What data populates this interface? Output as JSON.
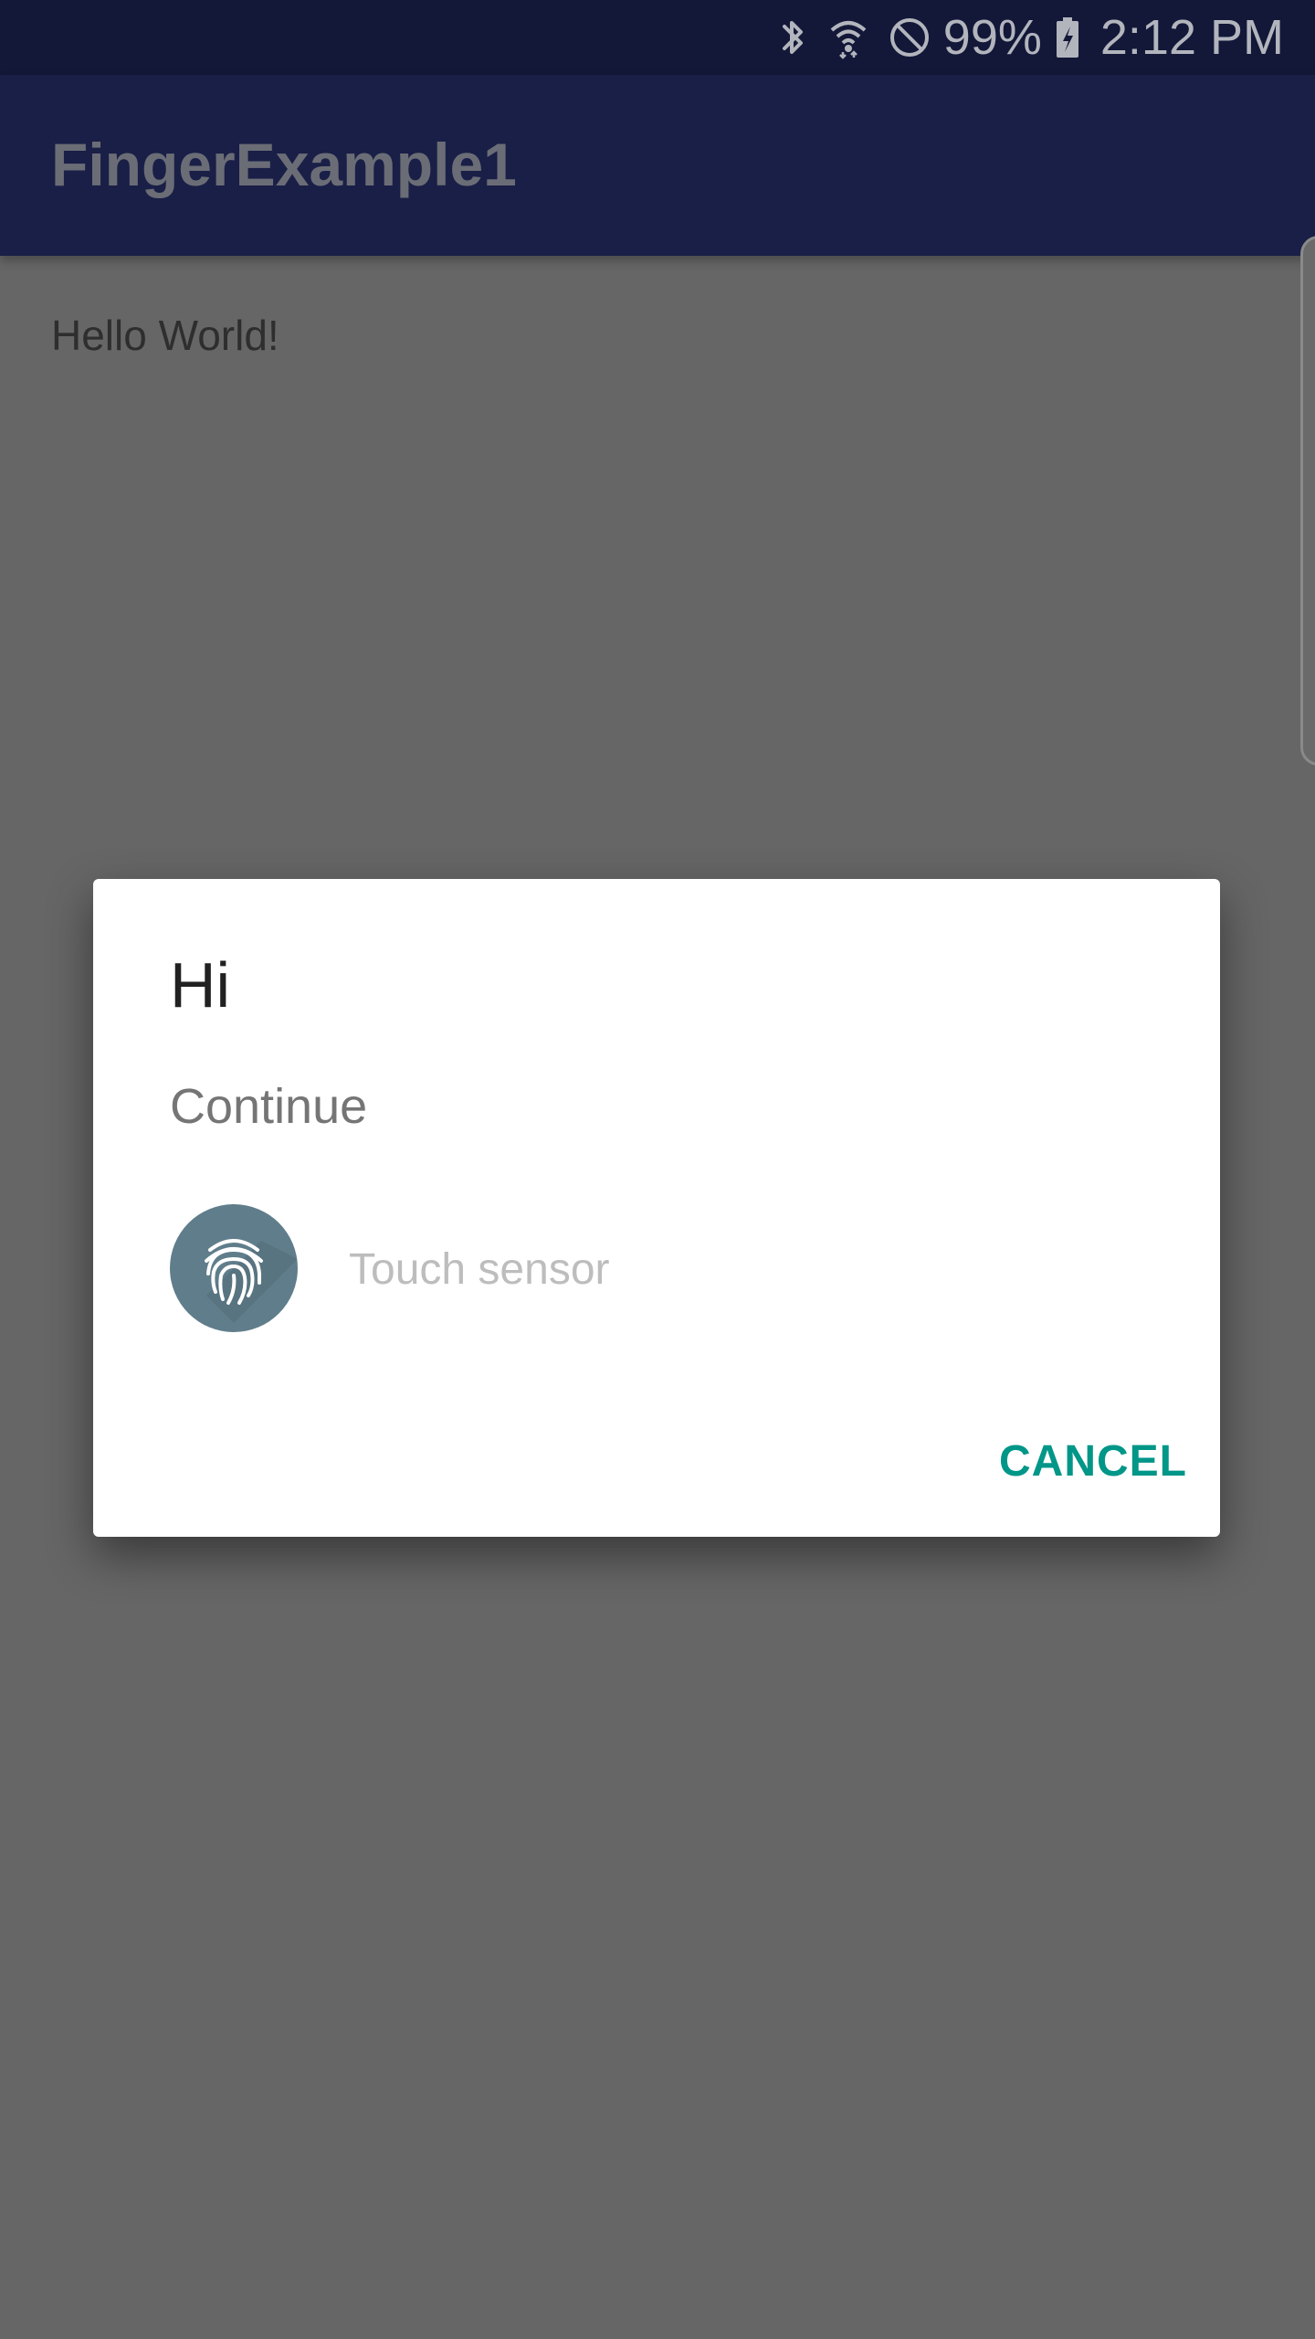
{
  "status_bar": {
    "battery": "99%",
    "time": "2:12 PM",
    "icons": [
      "bluetooth-icon",
      "wifi-icon",
      "do-not-disturb-icon",
      "battery-charging-icon"
    ]
  },
  "app_bar": {
    "title": "FingerExample1"
  },
  "main": {
    "text": "Hello World!"
  },
  "dialog": {
    "title": "Hi",
    "subtitle": "Continue",
    "sensor_label": "Touch sensor",
    "cancel_label": "CANCEL",
    "icon": "fingerprint-icon"
  },
  "colors": {
    "status_bar": "#131839",
    "app_bar": "#1a1f47",
    "scrim": "#666666",
    "accent": "#009688",
    "fingerprint_bg": "#607d8b"
  }
}
